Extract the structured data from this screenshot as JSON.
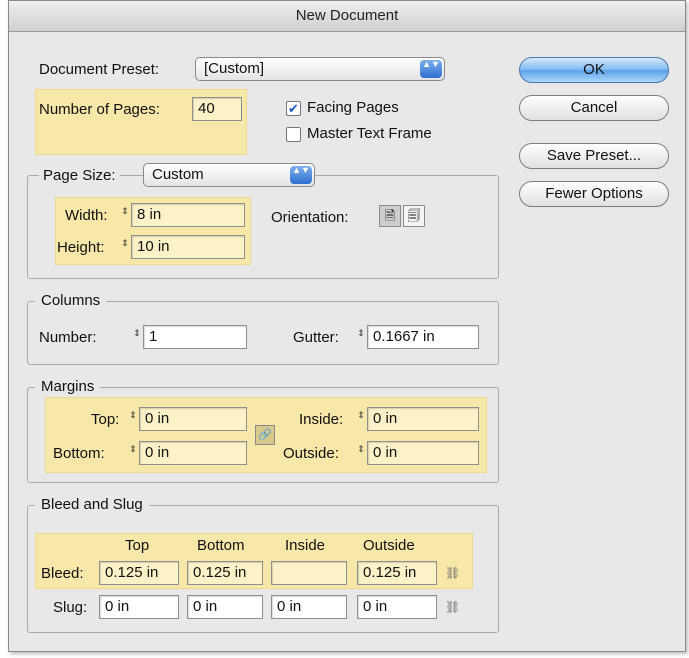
{
  "window": {
    "title": "New Document"
  },
  "preset": {
    "label": "Document Preset:",
    "value": "[Custom]"
  },
  "pages": {
    "label": "Number of Pages:",
    "value": "40"
  },
  "options": {
    "facing_pages": "Facing Pages",
    "facing_checked": true,
    "master_text_frame": "Master Text Frame",
    "master_checked": false
  },
  "buttons": {
    "ok": "OK",
    "cancel": "Cancel",
    "save_preset": "Save Preset...",
    "fewer_options": "Fewer Options"
  },
  "page_size": {
    "label": "Page Size:",
    "value": "Custom",
    "width_label": "Width:",
    "width": "8 in",
    "height_label": "Height:",
    "height": "10 in",
    "orientation_label": "Orientation:",
    "portrait_icon": "portrait-icon",
    "landscape_icon": "landscape-icon",
    "portrait_glyph": "🗎",
    "landscape_glyph": "🗐"
  },
  "columns": {
    "title": "Columns",
    "number_label": "Number:",
    "number": "1",
    "gutter_label": "Gutter:",
    "gutter": "0.1667 in"
  },
  "margins": {
    "title": "Margins",
    "top_label": "Top:",
    "top": "0 in",
    "bottom_label": "Bottom:",
    "bottom": "0 in",
    "inside_label": "Inside:",
    "inside": "0 in",
    "outside_label": "Outside:",
    "outside": "0 in",
    "link_glyph": "🔗"
  },
  "bleed_slug": {
    "title": "Bleed and Slug",
    "col_top": "Top",
    "col_bottom": "Bottom",
    "col_inside": "Inside",
    "col_outside": "Outside",
    "bleed_label": "Bleed:",
    "bleed_top": "0.125 in",
    "bleed_bottom": "0.125 in",
    "bleed_inside": "",
    "bleed_outside": "0.125 in",
    "slug_label": "Slug:",
    "slug_top": "0 in",
    "slug_bottom": "0 in",
    "slug_inside": "0 in",
    "slug_outside": "0 in",
    "chain_glyph": "⛓"
  },
  "icons": {
    "stepper": "⇕",
    "popup_arrow": "▲▼",
    "check": "✔"
  },
  "colors": {
    "highlight": "#f7e7a9",
    "accent": "#2e6fd0"
  }
}
